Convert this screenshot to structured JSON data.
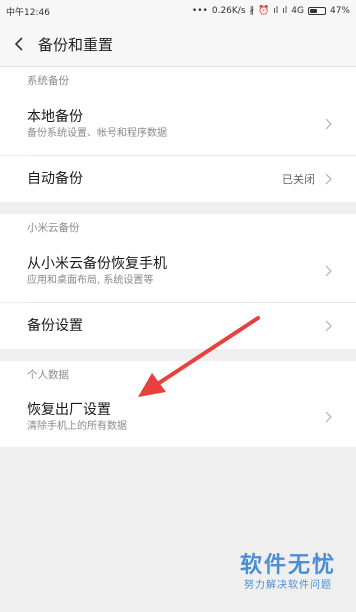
{
  "status_bar": {
    "left_text": "中午12:46",
    "speed": "0.26K/s",
    "network": "4G",
    "battery_percent": "47%",
    "battery_level": 0.47,
    "icons": [
      "bluetooth-icon",
      "alarm-icon",
      "signal-icon",
      "signal-icon-2"
    ]
  },
  "header": {
    "title": "备份和重置"
  },
  "sections": {
    "system": {
      "label": "系统备份",
      "local_backup": {
        "title": "本地备份",
        "subtitle": "备份系统设置、帐号和程序数据"
      },
      "auto_backup": {
        "title": "自动备份",
        "value": "已关闭"
      }
    },
    "cloud": {
      "label": "小米云备份",
      "restore": {
        "title": "从小米云备份恢复手机",
        "subtitle": "应用和桌面布局, 系统设置等"
      },
      "settings": {
        "title": "备份设置"
      }
    },
    "personal": {
      "label": "个人数据",
      "factory_reset": {
        "title": "恢复出厂设置",
        "subtitle": "清除手机上的所有数据"
      }
    }
  },
  "watermark": {
    "main": "软件无忧",
    "sub": "努力解决软件问题"
  },
  "colors": {
    "accent": "#4a8fd4",
    "arrow": "#e8403c"
  }
}
